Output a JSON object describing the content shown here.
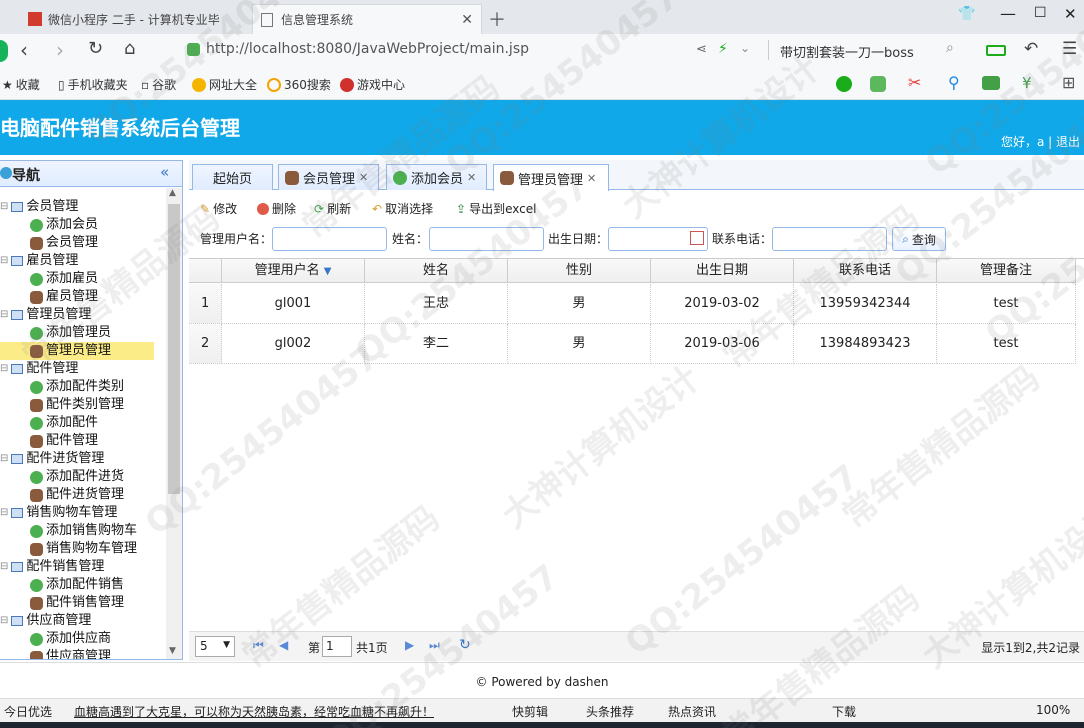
{
  "browser": {
    "tabs": [
      {
        "label": "微信小程序 二手 - 计算机专业毕"
      },
      {
        "label": "信息管理系统"
      }
    ],
    "url": "http://localhost:8080/JavaWebProject/main.jsp",
    "search_text": "带切割套装一刀一boss",
    "bookmarks": [
      "收藏",
      "手机收藏夹",
      "谷歌",
      "网址大全",
      "360搜索",
      "游戏中心"
    ]
  },
  "app": {
    "title": "电脑配件销售系统后台管理",
    "welcome": "您好，a | 退出"
  },
  "sidebar": {
    "title": "导航",
    "groups": [
      {
        "label": "会员管理",
        "items": [
          "添加会员",
          "会员管理"
        ]
      },
      {
        "label": "雇员管理",
        "items": [
          "添加雇员",
          "雇员管理"
        ]
      },
      {
        "label": "管理员管理",
        "items": [
          "添加管理员",
          "管理员管理"
        ]
      },
      {
        "label": "配件管理",
        "items": [
          "添加配件类别",
          "配件类别管理",
          "添加配件",
          "配件管理"
        ]
      },
      {
        "label": "配件进货管理",
        "items": [
          "添加配件进货",
          "配件进货管理"
        ]
      },
      {
        "label": "销售购物车管理",
        "items": [
          "添加销售购物车",
          "销售购物车管理"
        ]
      },
      {
        "label": "配件销售管理",
        "items": [
          "添加配件销售",
          "配件销售管理"
        ]
      },
      {
        "label": "供应商管理",
        "items": [
          "添加供应商",
          "供应商管理"
        ]
      }
    ],
    "selected": "管理员管理"
  },
  "tabs": [
    {
      "label": "起始页"
    },
    {
      "label": "会员管理"
    },
    {
      "label": "添加会员"
    },
    {
      "label": "管理员管理"
    }
  ],
  "toolbar": {
    "edit": "修改",
    "delete": "删除",
    "refresh": "刷新",
    "cancel": "取消选择",
    "export": "导出到excel"
  },
  "search": {
    "username_label": "管理用户名：",
    "name_label": "姓名：",
    "birth_label": "出生日期：",
    "phone_label": "联系电话：",
    "query": "查询"
  },
  "grid": {
    "columns": [
      "管理用户名",
      "姓名",
      "性别",
      "出生日期",
      "联系电话",
      "管理备注"
    ],
    "rows": [
      {
        "n": "1",
        "cells": [
          "gl001",
          "王忠",
          "男",
          "2019-03-02",
          "13959342344",
          "test"
        ]
      },
      {
        "n": "2",
        "cells": [
          "gl002",
          "李二",
          "男",
          "2019-03-06",
          "13984893423",
          "test"
        ]
      }
    ]
  },
  "pager": {
    "page_size": "5",
    "page_prefix": "第",
    "page": "1",
    "page_suffix": "共1页",
    "summary": "显示1到2,共2记录"
  },
  "footer": "© Powered by dashen",
  "statusbar": {
    "left": "今日优选",
    "news": "血糖高遇到了大克星，可以称为天然胰岛素，经常吃血糖不再飙升！",
    "items": [
      "快剪辑",
      "头条推荐",
      "热点资讯",
      "下载"
    ],
    "zoom": "100%"
  },
  "watermark": [
    "QQ:254540457",
    "常年售精品源码",
    "大神计算机设计"
  ]
}
